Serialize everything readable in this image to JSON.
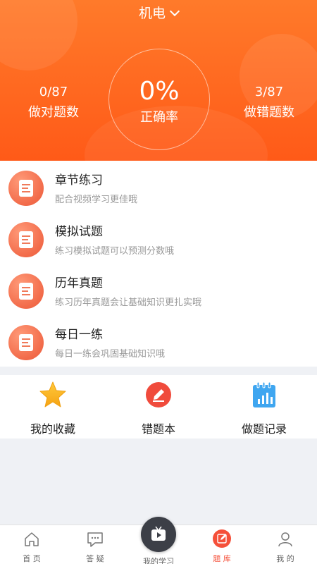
{
  "header": {
    "subject": "机电",
    "correct_count": "0/87",
    "correct_label": "做对题数",
    "rate": "0%",
    "rate_label": "正确率",
    "wrong_count": "3/87",
    "wrong_label": "做错题数"
  },
  "practice_list": [
    {
      "title": "章节练习",
      "desc": "配合视频学习更佳哦"
    },
    {
      "title": "模拟试题",
      "desc": "练习模拟试题可以预测分数哦"
    },
    {
      "title": "历年真题",
      "desc": "练习历年真题会让基础知识更扎实哦"
    },
    {
      "title": "每日一练",
      "desc": "每日一练会巩固基础知识哦"
    }
  ],
  "tools": [
    {
      "label": "我的收藏",
      "icon": "star-icon"
    },
    {
      "label": "错题本",
      "icon": "pencil-icon"
    },
    {
      "label": "做题记录",
      "icon": "chart-notebook-icon"
    }
  ],
  "nav": [
    {
      "label": "首 页",
      "icon": "home-icon"
    },
    {
      "label": "答 疑",
      "icon": "chat-icon"
    },
    {
      "label": "我的学习",
      "icon": "tv-play-icon"
    },
    {
      "label": "题 库",
      "icon": "edit-icon"
    },
    {
      "label": "我 的",
      "icon": "user-icon"
    }
  ],
  "colors": {
    "brand": "#ff5a18",
    "accent": "#f5503a",
    "item_icon": "#f26b4a"
  }
}
